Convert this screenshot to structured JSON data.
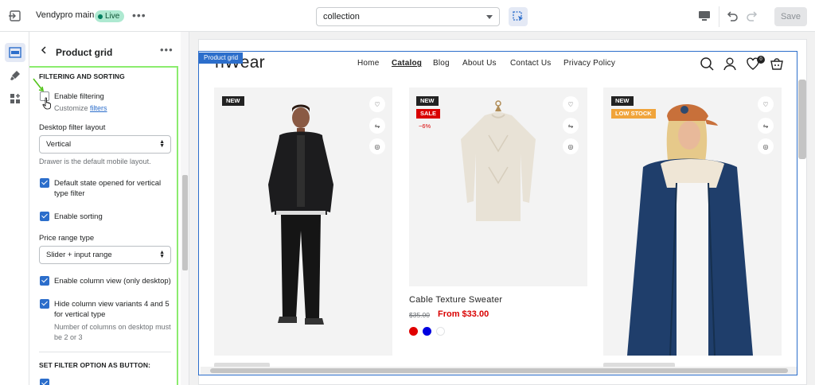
{
  "topbar": {
    "theme_name": "Vendypro main",
    "live_badge": "Live",
    "template_select": "collection",
    "save_label": "Save"
  },
  "panel": {
    "title": "Product grid",
    "section_filtering": "FILTERING AND SORTING",
    "enable_filtering": "Enable filtering",
    "customize_prefix": "Customize ",
    "customize_link": "filters",
    "desktop_layout_label": "Desktop filter layout",
    "desktop_layout_value": "Vertical",
    "desktop_layout_help": "Drawer is the default mobile layout.",
    "default_open": "Default state opened for vertical type filter",
    "enable_sorting": "Enable sorting",
    "price_range_label": "Price range type",
    "price_range_value": "Slider + input range",
    "column_view": "Enable column view (only desktop)",
    "hide_variants": "Hide column view variants 4 and 5 for vertical type",
    "hide_variants_help": "Number of columns on desktop must be 2 or 3",
    "section_button": "SET FILTER OPTION AS BUTTON:",
    "checkboxes": {
      "enable_filtering": false,
      "default_open": true,
      "enable_sorting": true,
      "column_view": true,
      "hide_variants": true
    }
  },
  "preview": {
    "section_tag": "Product grid",
    "logo": "ñWear",
    "nav": [
      "Home",
      "Catalog",
      "Blog",
      "About Us",
      "Contact Us",
      "Privacy Policy"
    ],
    "active_nav": "Catalog",
    "cart_count": "0",
    "products": [
      {
        "labels": [
          "NEW"
        ]
      },
      {
        "labels": [
          "NEW",
          "SALE"
        ],
        "discount": "−6%",
        "name": "Cable Texture Sweater",
        "price_old": "$35.00",
        "price_new": "From $33.00",
        "swatches": [
          "#e00000",
          "#0000e0",
          "#ffffff"
        ]
      },
      {
        "labels": [
          "NEW",
          "LOW STOCK"
        ]
      }
    ]
  }
}
